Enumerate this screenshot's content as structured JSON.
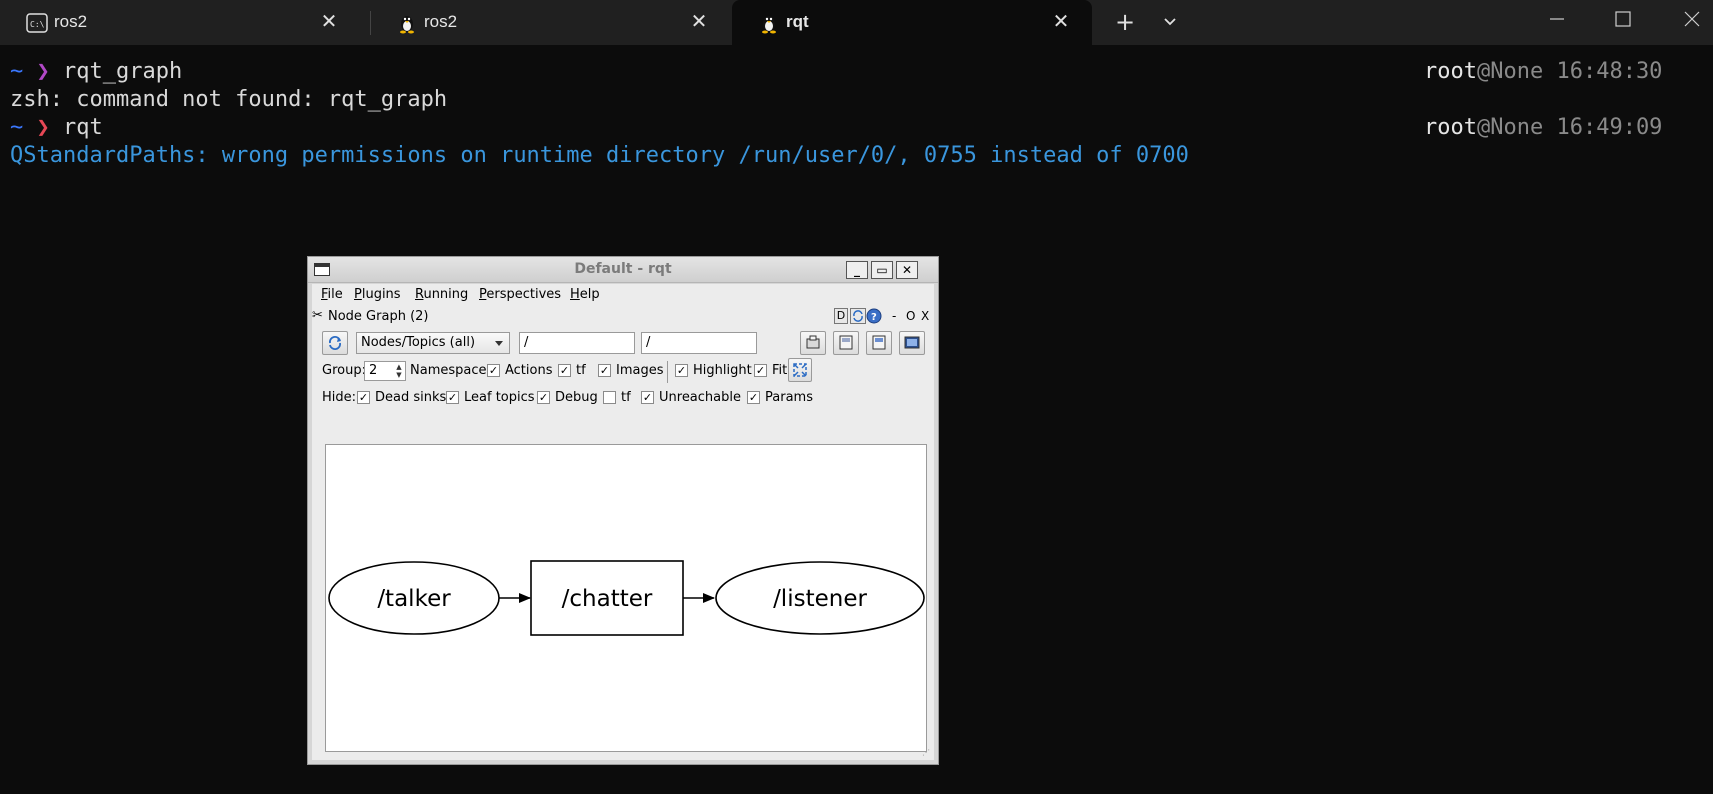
{
  "tabs": [
    {
      "label": "ros2",
      "icon": "cmd-icon",
      "active": false
    },
    {
      "label": "ros2",
      "icon": "linux-penguin-icon",
      "active": false
    },
    {
      "label": "rqt",
      "icon": "linux-penguin-icon",
      "active": true
    }
  ],
  "tabbar": {
    "new_tab": "+",
    "close": "✕"
  },
  "terminal": {
    "prompt_symbol": "~",
    "prompt_arrow": "❯",
    "lines": [
      {
        "command": "rqt_graph",
        "user": "root",
        "host": "@None",
        "time": "16:48:30"
      },
      {
        "output": "zsh: command not found: rqt_graph"
      },
      {
        "command": "rqt",
        "user": "root",
        "host": "@None",
        "time": "16:49:09"
      },
      {
        "warning": "QStandardPaths: wrong permissions on runtime directory /run/user/0/, 0755 instead of 0700"
      }
    ]
  },
  "rqt": {
    "title": "Default - rqt",
    "menu": [
      {
        "hot": "F",
        "rest": "ile"
      },
      {
        "hot": "P",
        "rest": "lugins"
      },
      {
        "hot": "R",
        "rest": "unning"
      },
      {
        "hot": "P",
        "rest": "erspectives"
      },
      {
        "hot": "H",
        "rest": "elp"
      }
    ],
    "dock_title": "Node Graph (2)",
    "dock_buttons": {
      "d": "D",
      "minimize": "-",
      "restore": "O",
      "close": "X"
    },
    "combo_value": "Nodes/Topics (all)",
    "filter1": "/",
    "filter2": "/",
    "group_label": "Group:",
    "group_value": "2",
    "row1_checks": [
      {
        "label": "Namespaces",
        "checked": true
      },
      {
        "label": "Actions",
        "checked": true
      },
      {
        "label": "tf",
        "checked": true
      },
      {
        "label": "Images",
        "checked": true
      },
      {
        "label": "Highlight",
        "checked": true
      },
      {
        "label": "Fit",
        "checked": true
      }
    ],
    "hide_label": "Hide:",
    "hide_checks": [
      {
        "label": "Dead sinks",
        "checked": true
      },
      {
        "label": "Leaf topics",
        "checked": true
      },
      {
        "label": "Debug",
        "checked": true
      },
      {
        "label": "tf",
        "checked": false
      },
      {
        "label": "Unreachable",
        "checked": true
      },
      {
        "label": "Params",
        "checked": true
      }
    ],
    "graph": {
      "nodes": [
        "/talker",
        "/listener"
      ],
      "topics": [
        "/chatter"
      ]
    }
  }
}
